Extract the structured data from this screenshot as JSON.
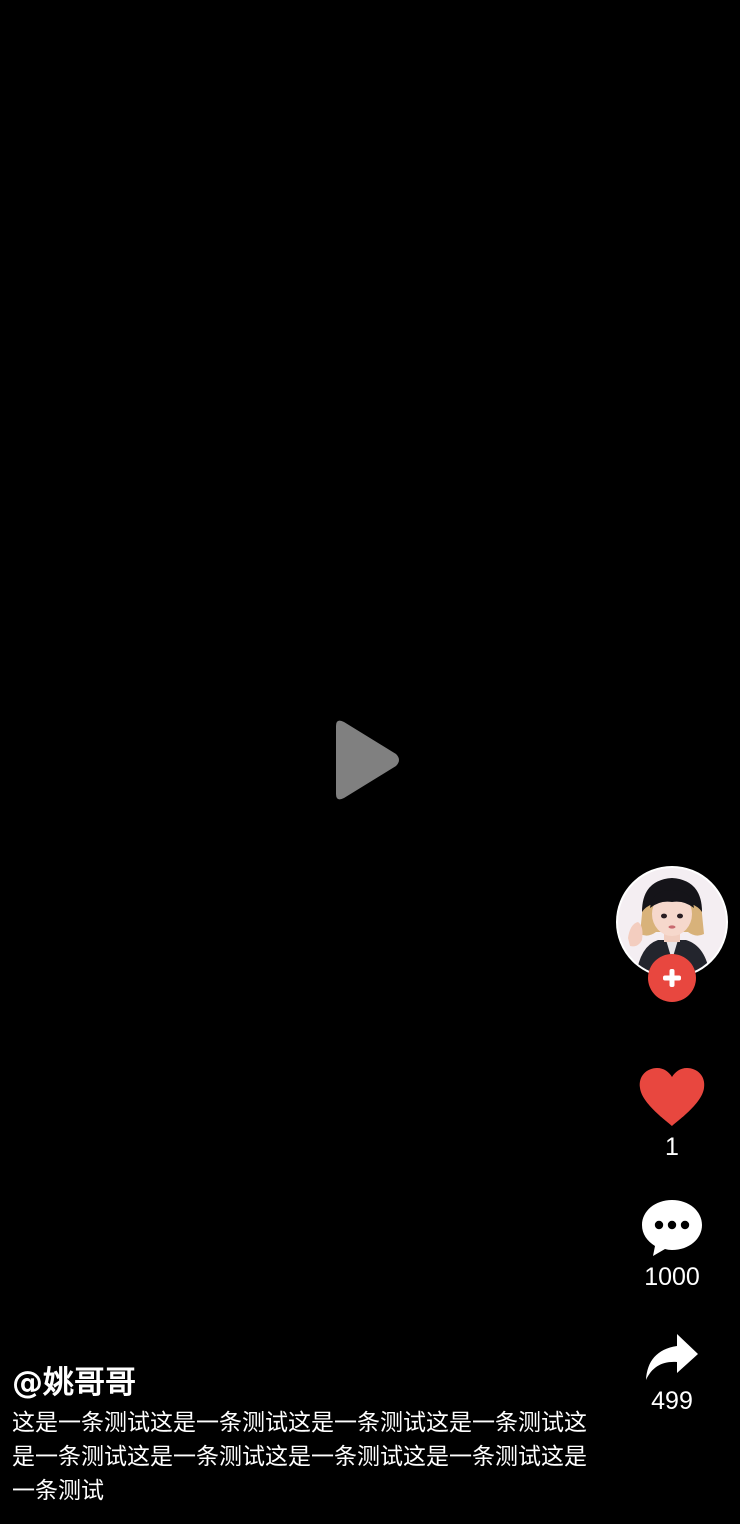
{
  "video": {
    "play_icon": "play-icon"
  },
  "author": {
    "avatar_icon": "avatar-image",
    "follow_icon": "plus-icon",
    "handle": "@姚哥哥"
  },
  "actions": {
    "like": {
      "icon": "heart-icon",
      "count": "1",
      "color": "#e8473f"
    },
    "comment": {
      "icon": "comment-bubble-icon",
      "count": "1000"
    },
    "share": {
      "icon": "share-arrow-icon",
      "count": "499"
    }
  },
  "caption": "这是一条测试这是一条测试这是一条测试这是一条测试这是一条测试这是一条测试这是一条测试这是一条测试这是一条测试",
  "colors": {
    "background": "#000000",
    "accent": "#e8473f",
    "play_icon": "#808080",
    "text": "#ffffff"
  }
}
